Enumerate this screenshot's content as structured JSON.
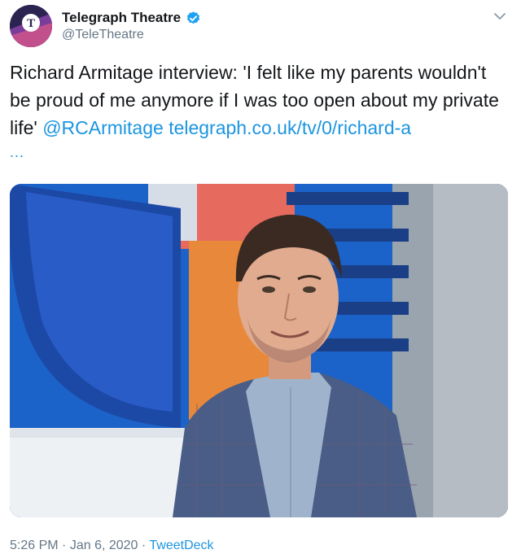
{
  "account": {
    "display_name": "Telegraph Theatre",
    "handle": "@TeleTheatre",
    "verified": true,
    "avatar_letter": "T"
  },
  "tweet": {
    "text_plain": "Richard Armitage interview: 'I felt like my parents wouldn't be proud of me anymore if I was too open about my private life' ",
    "mention": "@RCArmitage",
    "link": "telegraph.co.uk/tv/0/richard-a",
    "ellipsis": "..."
  },
  "media": {
    "type": "photo",
    "subject": "man in blue check blazer"
  },
  "meta": {
    "time": "5:26 PM",
    "date": "Jan 6, 2020",
    "separator": "·",
    "source": "TweetDeck"
  },
  "icons": {
    "avatar": "telegraph-logo-icon",
    "verified": "verified-badge-icon",
    "menu": "chevron-down-icon"
  },
  "colors": {
    "link": "#1b95e0",
    "secondary_text": "#657786",
    "verified": "#1da1f2"
  }
}
